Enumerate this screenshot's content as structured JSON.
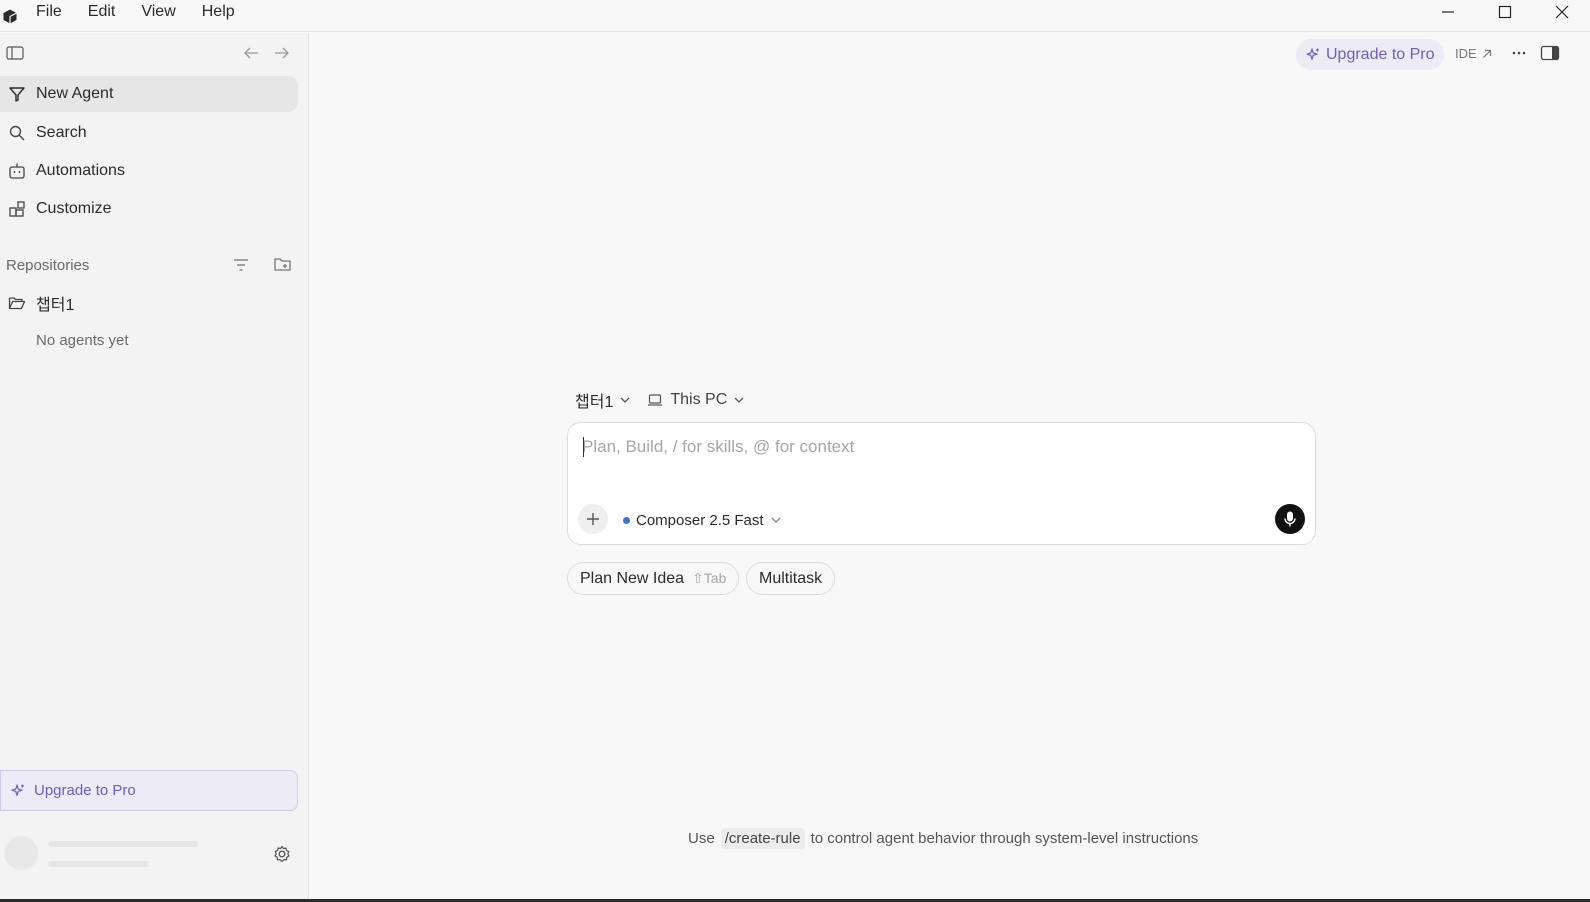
{
  "menu": {
    "items": [
      "File",
      "Edit",
      "View",
      "Help"
    ]
  },
  "sidebar": {
    "nav": [
      {
        "label": "New Agent",
        "icon": "funnel-agent-icon",
        "active": true
      },
      {
        "label": "Search",
        "icon": "search-icon",
        "active": false
      },
      {
        "label": "Automations",
        "icon": "robot-icon",
        "active": false
      },
      {
        "label": "Customize",
        "icon": "blocks-icon",
        "active": false
      }
    ],
    "repositories_label": "Repositories",
    "repo": {
      "name": "챕터1",
      "empty_text": "No agents yet"
    },
    "upgrade_label": "Upgrade to Pro"
  },
  "topbar": {
    "upgrade_label": "Upgrade to Pro",
    "ide_label": "IDE"
  },
  "composer": {
    "repo_selector": "챕터1",
    "location_selector": "This PC",
    "placeholder": "Plan, Build, / for skills, @ for context",
    "value": "",
    "model": "Composer 2.5 Fast"
  },
  "chips": {
    "plan_label": "Plan New Idea",
    "plan_hint": "⇧Tab",
    "multitask_label": "Multitask"
  },
  "footer": {
    "prefix": "Use",
    "command": "/create-rule",
    "suffix": "to control agent behavior through system-level instructions"
  },
  "colors": {
    "accent": "#6b5fc4",
    "accent_bg": "#ecebf6",
    "model_dot": "#3d73d6"
  }
}
